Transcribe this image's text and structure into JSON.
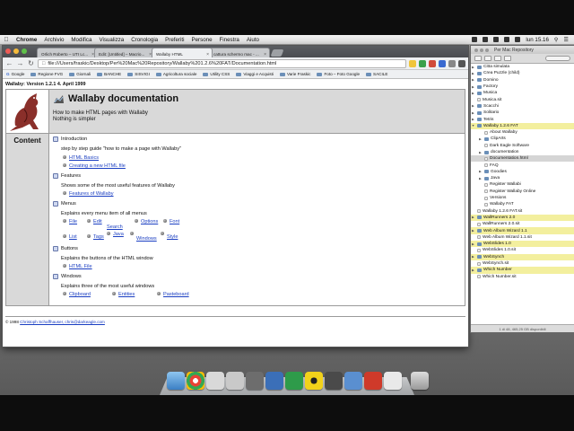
{
  "menubar": {
    "app": "Chrome",
    "items": [
      "Archivio",
      "Modifica",
      "Visualizza",
      "Cronologia",
      "Preferiti",
      "Persone",
      "Finestra",
      "Aiuto"
    ],
    "clock": "lun 15.16"
  },
  "browser": {
    "tabs": [
      {
        "label": "Orlich Roberto – UTI Lc..."
      },
      {
        "label": "Edit: [Untitled] – Macrio..."
      },
      {
        "label": "Wallaby HTML"
      },
      {
        "label": "cattura schermo mac - ..."
      }
    ],
    "url": "file:///Users/fraskic/Desktop/Per%20Mac%20Repository/Wallaby%201.2.6%20FAT/Documentation.html",
    "bookmarks": [
      "Google",
      "Regione FVG",
      "Giornali",
      "BANCHE",
      "SISVIGI",
      "Agricoltura sociale",
      "Utility CSS",
      "Viaggi e Acquisti",
      "Varie Fraskic",
      "Foto – Foto Google",
      "SACILE"
    ]
  },
  "page": {
    "version_line": "Wallaby: Version 1.2.1    4. April 1999",
    "title": "Wallaby documentation",
    "subtitle_1": "How to make HTML pages with Wallaby",
    "subtitle_2": "Nothing is simpler",
    "content_label": "Content",
    "sections": {
      "introduction": {
        "title": "Introduction",
        "desc": "step by step guide \"how to make a page with Wallaby\"",
        "links": [
          "HTML Basics",
          "Creating a new HTML file"
        ]
      },
      "features": {
        "title": "Features",
        "desc": "Shows some of the most useful features of Wallaby",
        "links": [
          "Features of Wallaby"
        ]
      },
      "menus": {
        "title": "Menus",
        "desc": "Explains every menu item of all menus",
        "links": [
          "File",
          "Edit",
          "Search",
          "Options",
          "Font",
          "List",
          "Tags",
          "Java",
          "Windows",
          "Style"
        ]
      },
      "buttons": {
        "title": "Buttons",
        "desc": "Explains the buttons of the HTML window",
        "links": [
          "HTML File"
        ]
      },
      "windows": {
        "title": "Windows",
        "desc": "Explains three of the most useful windows",
        "links": [
          "Clipboard",
          "Entities",
          "Pasteboard"
        ]
      }
    },
    "footer_prefix": "© 1998 ",
    "footer_link": "Christoph Schaffhauser, chris@darkeagle.com"
  },
  "finder": {
    "title": "Per Mac Repository",
    "items": [
      {
        "label": "Citta simulata",
        "kind": "folder",
        "highlight": "none"
      },
      {
        "label": "Crea Puzzle (child)",
        "kind": "folder",
        "highlight": "none"
      },
      {
        "label": "Domino",
        "kind": "folder",
        "highlight": "none"
      },
      {
        "label": "Factory",
        "kind": "folder",
        "highlight": "none"
      },
      {
        "label": "Musica",
        "kind": "folder",
        "highlight": "none"
      },
      {
        "label": "Musica.sit",
        "kind": "file",
        "highlight": "none"
      },
      {
        "label": "Scacchi",
        "kind": "folder",
        "highlight": "none"
      },
      {
        "label": "Solitario",
        "kind": "folder",
        "highlight": "none"
      },
      {
        "label": "Tetris",
        "kind": "folder",
        "highlight": "none"
      },
      {
        "label": "Wallaby 1.2.6 FAT",
        "kind": "folder",
        "highlight": "yellow"
      },
      {
        "label": "About Wallaby",
        "kind": "file",
        "highlight": "none"
      },
      {
        "label": "ClipArts",
        "kind": "folder",
        "highlight": "none"
      },
      {
        "label": "Dark Eagle Software",
        "kind": "file",
        "highlight": "none"
      },
      {
        "label": "documentation",
        "kind": "folder",
        "highlight": "none"
      },
      {
        "label": "Documentation.html",
        "kind": "file",
        "highlight": "selected"
      },
      {
        "label": "FAQ",
        "kind": "file",
        "highlight": "none"
      },
      {
        "label": "Goodies",
        "kind": "folder",
        "highlight": "none"
      },
      {
        "label": "Java",
        "kind": "folder",
        "highlight": "none"
      },
      {
        "label": "Register Wallabi",
        "kind": "file",
        "highlight": "none"
      },
      {
        "label": "Register Wallaby Online",
        "kind": "file",
        "highlight": "none"
      },
      {
        "label": "Versions",
        "kind": "file",
        "highlight": "none"
      },
      {
        "label": "Wallaby FAT",
        "kind": "file",
        "highlight": "none"
      },
      {
        "label": "Wallaby 1.2.6 FAT.sit",
        "kind": "file",
        "highlight": "none"
      },
      {
        "label": "WallRunners 2.0",
        "kind": "folder",
        "highlight": "yellow"
      },
      {
        "label": "WallRunners 2.0.sit",
        "kind": "file",
        "highlight": "none"
      },
      {
        "label": "Web Album Wizard 1.1",
        "kind": "folder",
        "highlight": "yellow"
      },
      {
        "label": "Web Album Wizard 1.1.sit",
        "kind": "file",
        "highlight": "none"
      },
      {
        "label": "WebSlides 1.0",
        "kind": "folder",
        "highlight": "yellow"
      },
      {
        "label": "WebSlides 1.0.sit",
        "kind": "file",
        "highlight": "none"
      },
      {
        "label": "WebSynch",
        "kind": "folder",
        "highlight": "yellow"
      },
      {
        "label": "WebSynch.sit",
        "kind": "file",
        "highlight": "none"
      },
      {
        "label": "Which Number",
        "kind": "folder",
        "highlight": "yellow"
      },
      {
        "label": "Which Number.sit",
        "kind": "file",
        "highlight": "none"
      }
    ],
    "status": "1 di 48, 465,25 GB disponibili"
  },
  "colors": {
    "link": "#1a3ec2",
    "title_bg": "#d9d9d9",
    "finder_highlight": "#f3ef9e"
  }
}
